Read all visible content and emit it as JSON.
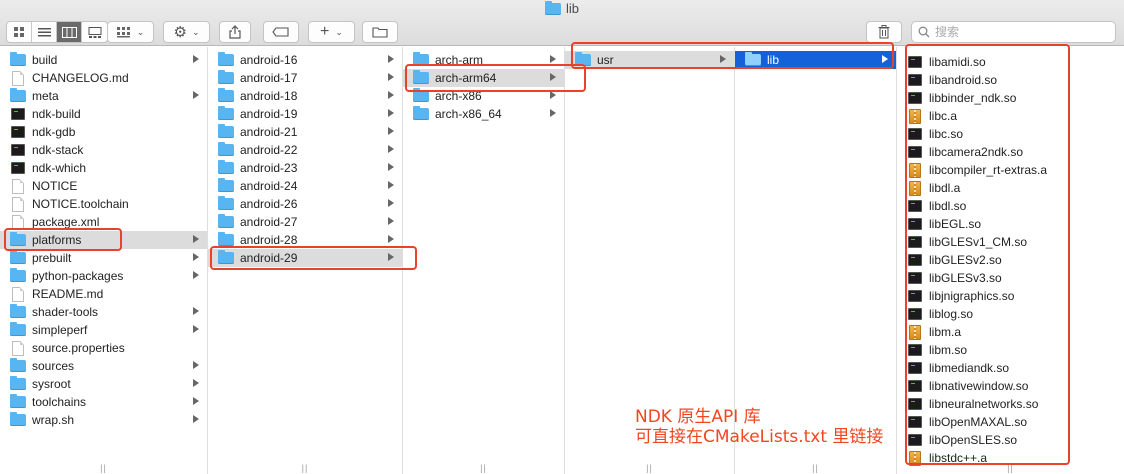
{
  "window": {
    "title": "lib"
  },
  "toolbar": {
    "search_placeholder": "搜索",
    "icons": [
      "list-view-icon",
      "column-view-icon",
      "gallery-view-icon",
      "arrange-icon",
      "gear-icon",
      "share-icon",
      "tag-icon",
      "plus-icon",
      "new-folder-icon",
      "trash-icon",
      "search-icon"
    ]
  },
  "col1": {
    "items": [
      {
        "name": "build",
        "type": "folder",
        "arrow": true
      },
      {
        "name": "CHANGELOG.md",
        "type": "doc",
        "arrow": false
      },
      {
        "name": "meta",
        "type": "folder",
        "arrow": true
      },
      {
        "name": "ndk-build",
        "type": "exec",
        "arrow": false
      },
      {
        "name": "ndk-gdb",
        "type": "exec",
        "arrow": false
      },
      {
        "name": "ndk-stack",
        "type": "exec",
        "arrow": false
      },
      {
        "name": "ndk-which",
        "type": "exec",
        "arrow": false
      },
      {
        "name": "NOTICE",
        "type": "doc",
        "arrow": false
      },
      {
        "name": "NOTICE.toolchain",
        "type": "doc",
        "arrow": false
      },
      {
        "name": "package.xml",
        "type": "doc",
        "arrow": false
      },
      {
        "name": "platforms",
        "type": "folder",
        "arrow": true,
        "selected": "grey"
      },
      {
        "name": "prebuilt",
        "type": "folder",
        "arrow": true
      },
      {
        "name": "python-packages",
        "type": "folder",
        "arrow": true
      },
      {
        "name": "README.md",
        "type": "doc",
        "arrow": false
      },
      {
        "name": "shader-tools",
        "type": "folder",
        "arrow": true
      },
      {
        "name": "simpleperf",
        "type": "folder",
        "arrow": true
      },
      {
        "name": "source.properties",
        "type": "doc",
        "arrow": false
      },
      {
        "name": "sources",
        "type": "folder",
        "arrow": true
      },
      {
        "name": "sysroot",
        "type": "folder",
        "arrow": true
      },
      {
        "name": "toolchains",
        "type": "folder",
        "arrow": true
      },
      {
        "name": "wrap.sh",
        "type": "folder",
        "arrow": true
      }
    ]
  },
  "col2": {
    "items": [
      {
        "name": "android-16",
        "type": "folder",
        "arrow": true
      },
      {
        "name": "android-17",
        "type": "folder",
        "arrow": true
      },
      {
        "name": "android-18",
        "type": "folder",
        "arrow": true
      },
      {
        "name": "android-19",
        "type": "folder",
        "arrow": true
      },
      {
        "name": "android-21",
        "type": "folder",
        "arrow": true
      },
      {
        "name": "android-22",
        "type": "folder",
        "arrow": true
      },
      {
        "name": "android-23",
        "type": "folder",
        "arrow": true
      },
      {
        "name": "android-24",
        "type": "folder",
        "arrow": true
      },
      {
        "name": "android-26",
        "type": "folder",
        "arrow": true
      },
      {
        "name": "android-27",
        "type": "folder",
        "arrow": true
      },
      {
        "name": "android-28",
        "type": "folder",
        "arrow": true
      },
      {
        "name": "android-29",
        "type": "folder",
        "arrow": true,
        "selected": "grey"
      }
    ]
  },
  "col3": {
    "items": [
      {
        "name": "arch-arm",
        "type": "folder",
        "arrow": true
      },
      {
        "name": "arch-arm64",
        "type": "folder",
        "arrow": true,
        "selected": "grey"
      },
      {
        "name": "arch-x86",
        "type": "folder",
        "arrow": true
      },
      {
        "name": "arch-x86_64",
        "type": "folder",
        "arrow": true
      }
    ]
  },
  "col4": {
    "items": [
      {
        "name": "usr",
        "type": "folder",
        "arrow": true,
        "selected": "grey"
      }
    ]
  },
  "col5": {
    "items": [
      {
        "name": "lib",
        "type": "folder",
        "arrow": true,
        "selected": "blue"
      }
    ]
  },
  "col6": {
    "items": [
      {
        "name": "libamidi.so",
        "type": "exec"
      },
      {
        "name": "libandroid.so",
        "type": "exec"
      },
      {
        "name": "libbinder_ndk.so",
        "type": "exec"
      },
      {
        "name": "libc.a",
        "type": "archive"
      },
      {
        "name": "libc.so",
        "type": "exec"
      },
      {
        "name": "libcamera2ndk.so",
        "type": "exec"
      },
      {
        "name": "libcompiler_rt-extras.a",
        "type": "archive"
      },
      {
        "name": "libdl.a",
        "type": "archive"
      },
      {
        "name": "libdl.so",
        "type": "exec"
      },
      {
        "name": "libEGL.so",
        "type": "exec"
      },
      {
        "name": "libGLESv1_CM.so",
        "type": "exec"
      },
      {
        "name": "libGLESv2.so",
        "type": "exec"
      },
      {
        "name": "libGLESv3.so",
        "type": "exec"
      },
      {
        "name": "libjnigraphics.so",
        "type": "exec"
      },
      {
        "name": "liblog.so",
        "type": "exec"
      },
      {
        "name": "libm.a",
        "type": "archive"
      },
      {
        "name": "libm.so",
        "type": "exec"
      },
      {
        "name": "libmediandk.so",
        "type": "exec"
      },
      {
        "name": "libnativewindow.so",
        "type": "exec"
      },
      {
        "name": "libneuralnetworks.so",
        "type": "exec"
      },
      {
        "name": "libOpenMAXAL.so",
        "type": "exec"
      },
      {
        "name": "libOpenSLES.so",
        "type": "exec"
      },
      {
        "name": "libstdc++.a",
        "type": "archive"
      }
    ]
  },
  "annotation": {
    "line1": "NDK 原生API 库",
    "line2": "可直接在CMakeLists.txt 里链接"
  },
  "colors": {
    "highlight": "#e8432a",
    "selection_blue": "#1462d9",
    "folder": "#58b5ef"
  }
}
